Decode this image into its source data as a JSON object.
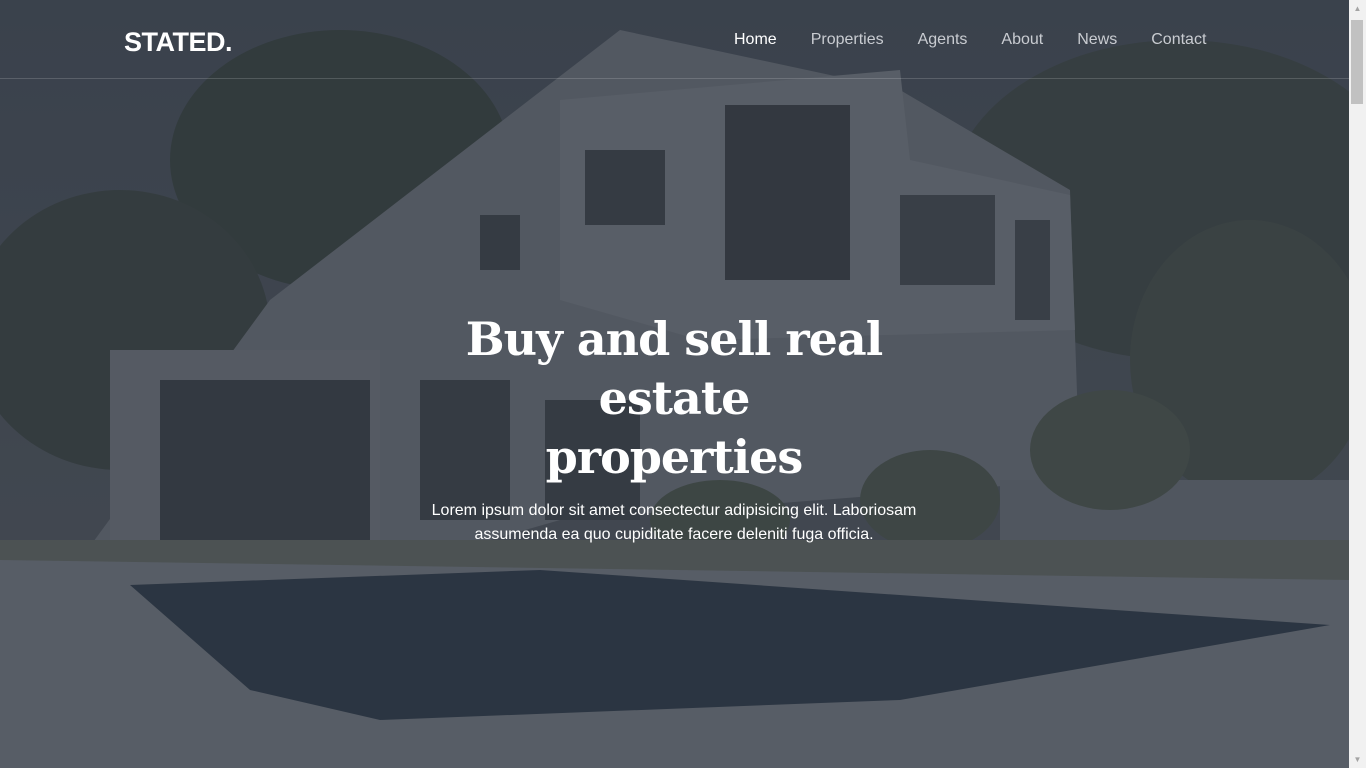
{
  "brand": {
    "logo": "STATED."
  },
  "nav": {
    "items": [
      {
        "label": "Home",
        "active": true
      },
      {
        "label": "Properties",
        "active": false
      },
      {
        "label": "Agents",
        "active": false
      },
      {
        "label": "About",
        "active": false
      },
      {
        "label": "News",
        "active": false
      },
      {
        "label": "Contact",
        "active": false
      }
    ]
  },
  "hero": {
    "headline_line1": "Buy and sell real estate",
    "headline_line2": "properties",
    "subtext_line1": "Lorem ipsum dolor sit amet consectectur adipisicing elit. Laboriosam",
    "subtext_line2": "assumenda ea quo cupiditate facere deleniti fuga officia.",
    "background_image": "modern-house-with-pool-photo"
  },
  "colors": {
    "overlay": "#282e3a",
    "text": "#ffffff",
    "nav_inactive": "#c9ccd1"
  }
}
